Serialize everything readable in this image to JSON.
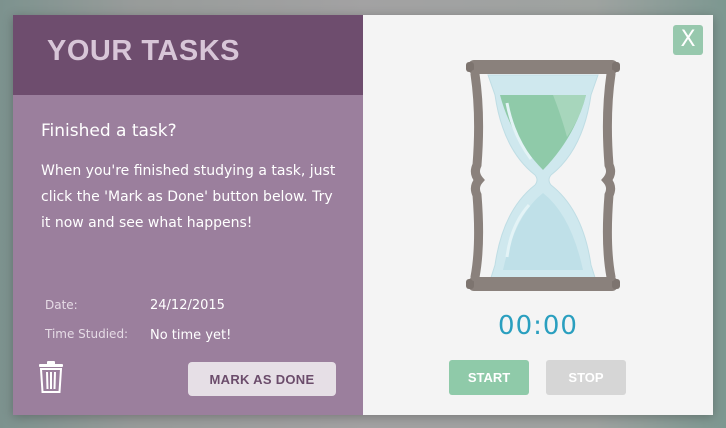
{
  "tasks_panel": {
    "header_title": "YOUR TASKS",
    "task_title": "Finished a task?",
    "task_description": "When you're finished studying a task, just click the 'Mark as Done' button below. Try it now and see what happens!",
    "date_label": "Date:",
    "date_value": "24/12/2015",
    "time_label": "Time Studied:",
    "time_value": "No time yet!",
    "mark_done_label": "MARK AS DONE",
    "delete_icon": "trash-icon"
  },
  "timer_panel": {
    "close_label": "X",
    "time_display": "00:00",
    "start_label": "START",
    "stop_label": "STOP",
    "hourglass_icon": "hourglass-icon"
  },
  "colors": {
    "header_bg": "#6e4d6e",
    "panel_bg": "#9b7f9d",
    "accent_green": "#8fcaa9",
    "timer_blue": "#2a9fbf"
  }
}
